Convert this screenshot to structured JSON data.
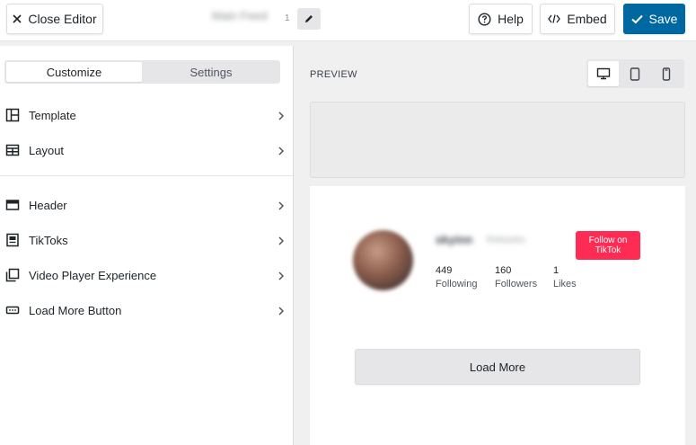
{
  "toolbar": {
    "close_label": "Close Editor",
    "feed_name": "Main Feed",
    "feed_name_suffix": "1",
    "help_label": "Help",
    "embed_label": "Embed",
    "save_label": "Save"
  },
  "sidebar": {
    "tabs": [
      {
        "label": "Customize",
        "active": true
      },
      {
        "label": "Settings",
        "active": false
      }
    ],
    "items": [
      {
        "label": "Template",
        "icon": "template-icon"
      },
      {
        "label": "Layout",
        "icon": "layout-icon"
      },
      {
        "label": "Header",
        "icon": "header-icon"
      },
      {
        "label": "TikToks",
        "icon": "tiktoks-icon"
      },
      {
        "label": "Video Player Experience",
        "icon": "video-player-icon"
      },
      {
        "label": "Load More Button",
        "icon": "load-more-icon"
      }
    ]
  },
  "preview": {
    "label": "PREVIEW",
    "devices": [
      "desktop-icon",
      "tablet-icon",
      "mobile-icon"
    ],
    "active_device": "desktop-icon"
  },
  "profile": {
    "username": "skyinn",
    "display_name": "Rekeeks",
    "stats": [
      {
        "value": "449",
        "label": "Following"
      },
      {
        "value": "160",
        "label": "Followers"
      },
      {
        "value": "1",
        "label": "Likes"
      }
    ],
    "follow_label": "Follow on TikTok"
  },
  "load_more_label": "Load More",
  "colors": {
    "save_button": "#0068a0",
    "follow_button": "#fe2c55",
    "background": "#f0f0f1"
  }
}
